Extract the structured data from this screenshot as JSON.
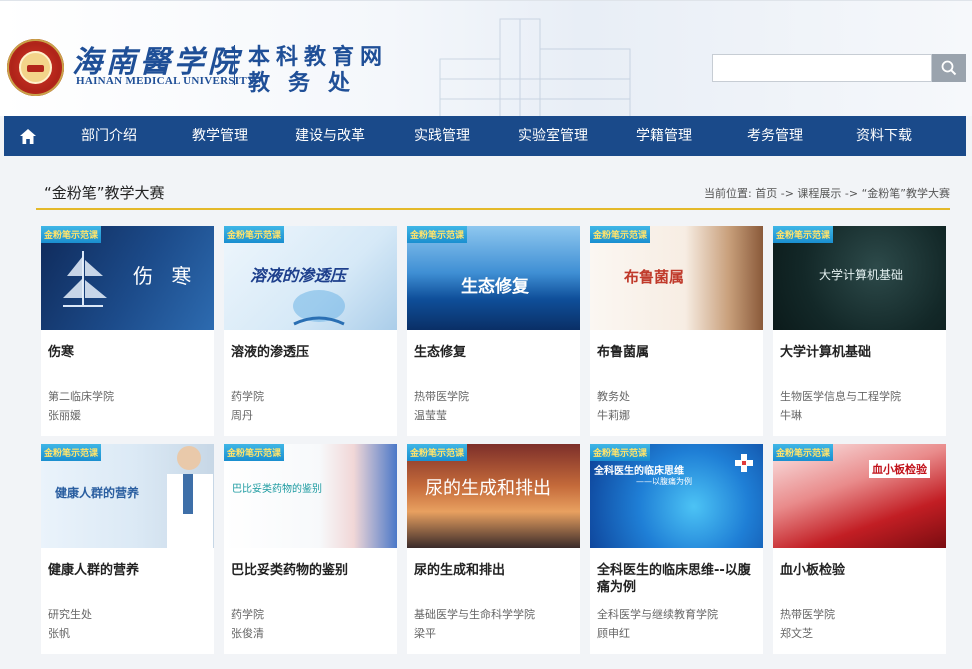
{
  "header": {
    "school_cn": "海南醫学院",
    "school_en": "HAINAN MEDICAL UNIVERSITY",
    "dept_line1": "本科教育网",
    "dept_line2": "教务处",
    "search": {
      "placeholder": ""
    }
  },
  "nav": {
    "home_icon": "home-icon",
    "items": [
      "部门介绍",
      "教学管理",
      "建设与改革",
      "实践管理",
      "实验室管理",
      "学籍管理",
      "考务管理",
      "资料下载"
    ]
  },
  "page": {
    "title": "“金粉笔”教学大赛",
    "breadcrumb": {
      "prefix": "当前位置:",
      "home": "首页",
      "sep1": "->",
      "level2": "课程展示",
      "sep2": "->",
      "current": "“金粉笔”教学大赛"
    }
  },
  "courses": [
    {
      "tag": "金粉笔示范课",
      "thumb_text": "伤 寒",
      "name": "伤寒",
      "college": "第二临床学院",
      "teacher": "张丽媛"
    },
    {
      "tag": "金粉笔示范课",
      "thumb_text": "溶液的渗透压",
      "name": "溶液的渗透压",
      "college": "药学院",
      "teacher": "周丹"
    },
    {
      "tag": "金粉笔示范课",
      "thumb_text": "生态修复",
      "name": "生态修复",
      "college": "热带医学院",
      "teacher": "温莹莹"
    },
    {
      "tag": "金粉笔示范课",
      "thumb_text": "布鲁菌属",
      "name": "布鲁菌属",
      "college": "教务处",
      "teacher": "牛莉娜"
    },
    {
      "tag": "金粉笔示范课",
      "thumb_text": "大学计算机基础",
      "name": "大学计算机基础",
      "college": "生物医学信息与工程学院",
      "teacher": "牛琳"
    },
    {
      "tag": "金粉笔示范课",
      "thumb_text": "健康人群的营养",
      "name": "健康人群的营养",
      "college": "研究生处",
      "teacher": "张帆"
    },
    {
      "tag": "金粉笔示范课",
      "thumb_text": "巴比妥类药物的鉴别",
      "name": "巴比妥类药物的鉴别",
      "college": "药学院",
      "teacher": "张俊清"
    },
    {
      "tag": "金粉笔示范课",
      "thumb_text": "尿的生成和排出",
      "name": "尿的生成和排出",
      "college": "基础医学与生命科学学院",
      "teacher": "梁平"
    },
    {
      "tag": "金粉笔示范课",
      "thumb_text": "全科医生的临床思维",
      "thumb_sub": "——以腹痛为例",
      "name": "全科医生的临床思维--以腹痛为例",
      "college": "全科医学与继续教育学院",
      "teacher": "顾申红"
    },
    {
      "tag": "金粉笔示范课",
      "thumb_text": "血小板检验",
      "name": "血小板检验",
      "college": "热带医学院",
      "teacher": "郑文芝"
    }
  ],
  "colors": {
    "nav_bg": "#1a4a8a",
    "brand_blue": "#1f4f97",
    "accent_gold": "#e4b92a"
  }
}
